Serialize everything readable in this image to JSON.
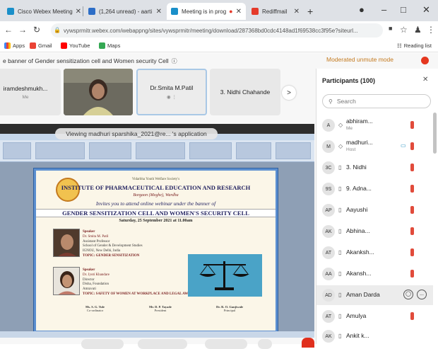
{
  "browser": {
    "tabs": [
      {
        "label": "Cisco Webex Meeting",
        "color": "#1a8fc9"
      },
      {
        "label": "(1,264 unread) - aarti",
        "color": "#2d6ec7"
      },
      {
        "label": "Meeting is in prog",
        "color": "#1a8fc9"
      },
      {
        "label": "Rediffmail",
        "color": "#e53a2a"
      }
    ],
    "url": "vywsprmitr.webex.com/webappng/sites/vywsprmitr/meeting/download/287368bd0cdc4148ad1f69538cc3f95e?siteurl...",
    "bookmarks": [
      "Apps",
      "Gmail",
      "YouTube",
      "Maps"
    ],
    "reading_list": "Reading list"
  },
  "meeting": {
    "banner": "e banner of Gender sensitization cell and Women security Cell",
    "moderated_label": "Moderated unmute mode",
    "thumbnails": [
      {
        "name": "iramdeshmukh...",
        "sub": "Me"
      },
      {
        "name": "",
        "sub": ""
      },
      {
        "name": "Dr.Smita M.Patil",
        "sub": ""
      },
      {
        "name": "3. Nidhi Chahande",
        "sub": ""
      }
    ],
    "scroll_next": ">",
    "viewing": "Viewing madhuri sparshika_2021@re... 's application"
  },
  "slide": {
    "society": "Vidarbha Youth Welfare Society's",
    "institute": "INSTITUTE OF PHARMACEUTICAL EDUCATION AND RESEARCH",
    "place": "Borgaon (Meghe), Wardha",
    "invite": "Invites you to attend online webinar under the banner of",
    "event": "GENDER SENSITIZATION CELL AND WOMEN'S SECURITY CELL",
    "date": "Saturday, 25 September 2021 at 11.00am",
    "speaker1": {
      "label": "Speaker",
      "name": "Dr. Smita M. Patil",
      "role": "Assistant Professor",
      "dept": "School of Gender & Development Studies",
      "org": "IGNOU, New Delhi, India",
      "topic": "TOPIC: GENDER SENSITIZATION"
    },
    "speaker2": {
      "label": "Speaker",
      "name": "Dr. Jyoti Khandare",
      "role": "Director",
      "org": "Disha, Foundation",
      "city": "Amravati",
      "topic": "TOPIC: SAFETY OF WOMEN AT WORKPLACE AND LEGAL AWARENESS"
    },
    "footer": [
      {
        "name": "Ms. S. G. Tule",
        "role": "Co-ordinator"
      },
      {
        "name": "Mr. D. P. Tayade",
        "role": "President"
      },
      {
        "name": "Dr. R. O. Ganjiwale",
        "role": "Principal"
      }
    ]
  },
  "participants": {
    "title": "Participants (100)",
    "search_placeholder": "Search",
    "list": [
      {
        "initials": "A",
        "name": "abhiram...",
        "role": "Me"
      },
      {
        "initials": "M",
        "name": "madhuri...",
        "role": "Host"
      },
      {
        "initials": "3C",
        "name": "3. Nidhi",
        "role": ""
      },
      {
        "initials": "9S",
        "name": "9. Adna...",
        "role": ""
      },
      {
        "initials": "AP",
        "name": "Aayushi",
        "role": ""
      },
      {
        "initials": "AK",
        "name": "Abhina...",
        "role": ""
      },
      {
        "initials": "AT",
        "name": "Akanksh...",
        "role": ""
      },
      {
        "initials": "AA",
        "name": "Akansh...",
        "role": ""
      },
      {
        "initials": "AD",
        "name": "Aman Darda",
        "role": ""
      },
      {
        "initials": "AT",
        "name": "Amulya",
        "role": ""
      },
      {
        "initials": "AK",
        "name": "Ankit k...",
        "role": ""
      }
    ],
    "more_icon": "..."
  },
  "colors": {
    "webex_blue": "#1a8fc9",
    "muted_red": "#e14b3b",
    "moderated_orange": "#c47a1f",
    "end_red": "#e02f1d"
  }
}
